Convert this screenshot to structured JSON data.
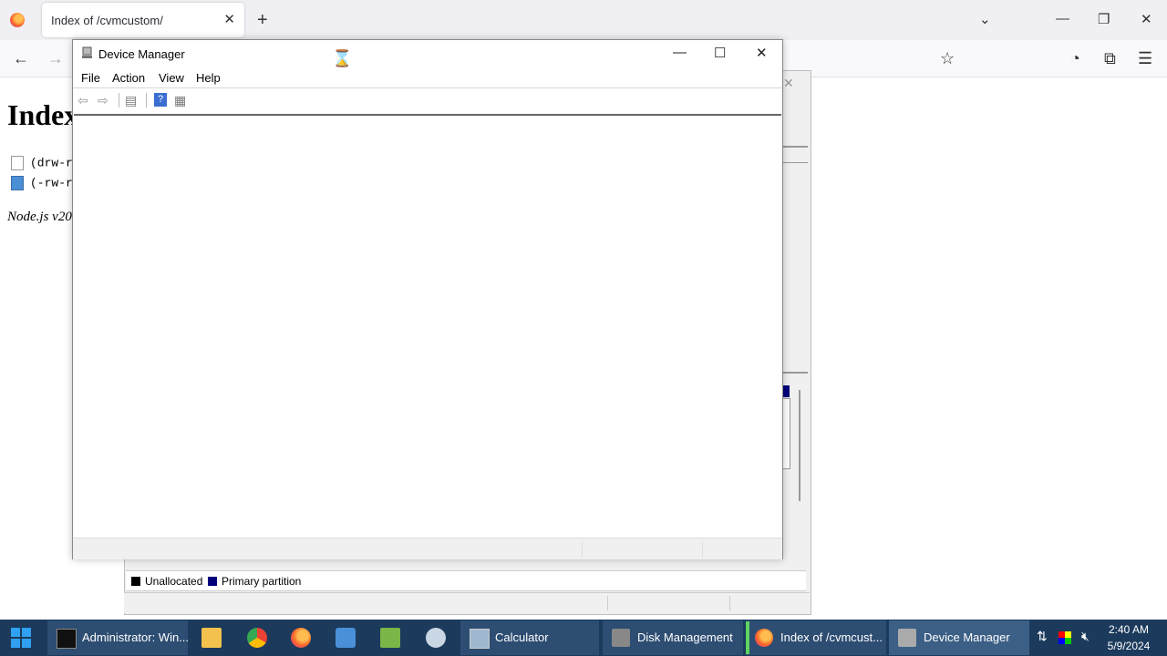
{
  "browser": {
    "tab_title": "Index of /cvmcustom/",
    "close_tab_glyph": "✕",
    "new_tab_glyph": "+",
    "tab_list_glyph": "⌄",
    "minimize_glyph": "—",
    "restore_glyph": "❐",
    "close_glyph": "✕"
  },
  "page": {
    "heading": "Index",
    "files": [
      {
        "text": "(drw-rw",
        "icon": "folder-file-icon"
      },
      {
        "text": "(-rw-rw",
        "icon": "document-icon"
      }
    ],
    "footer": "Node.js v20"
  },
  "disk_management": {
    "legend": [
      {
        "label": "Unallocated",
        "color": "#000000"
      },
      {
        "label": "Primary partition",
        "color": "#00007b"
      }
    ]
  },
  "device_manager": {
    "title": "Device Manager",
    "menu": [
      "File",
      "Action",
      "View",
      "Help"
    ],
    "minimize_glyph": "—",
    "maximize_glyph": "☐",
    "close_glyph": "✕"
  },
  "taskbar": {
    "items": [
      {
        "label": "Administrator: Win...",
        "icon": "terminal-icon"
      },
      {
        "label": "Calculator",
        "icon": "calculator-icon"
      },
      {
        "label": "Disk Management",
        "icon": "disk-icon"
      },
      {
        "label": "Index of /cvmcust...",
        "icon": "firefox-icon"
      },
      {
        "label": "Device Manager",
        "icon": "device-manager-icon"
      }
    ],
    "time": "2:40 AM",
    "date": "5/9/2024"
  }
}
